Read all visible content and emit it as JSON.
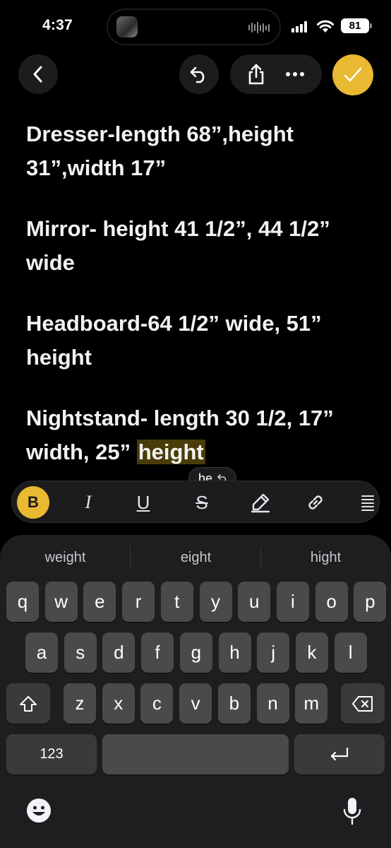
{
  "status_bar": {
    "time": "4:37",
    "battery": "81"
  },
  "toolbar": {
    "back_icon": "chevron-left-icon",
    "undo_icon": "undo-icon",
    "share_icon": "share-icon",
    "more_icon": "more-horizontal-icon",
    "done_icon": "checkmark-icon",
    "accent_color": "#e8b931"
  },
  "note": {
    "lines": [
      {
        "text": "Dresser-length 68”,height 31”,width 17”"
      },
      {
        "text": "Mirror- height 41 1/2”, 44 1/2” wide"
      },
      {
        "text": "Headboard-64 1/2” wide, 51” height"
      },
      {
        "text_before": "Nightstand- length 30 1/2, 17” width, 25” ",
        "highlighted": "height"
      }
    ]
  },
  "autocorrect": {
    "text": "he",
    "icon": "revert-icon"
  },
  "format_bar": {
    "bold": "B",
    "italic": "I",
    "underline": "U",
    "strikethrough": "S",
    "icons": [
      "bold-icon",
      "italic-icon",
      "underline-icon",
      "strikethrough-icon",
      "highlighter-icon",
      "link-icon",
      "list-icon"
    ]
  },
  "keyboard": {
    "suggestions": [
      "weight",
      "eight",
      "hight"
    ],
    "row1": [
      "q",
      "w",
      "e",
      "r",
      "t",
      "y",
      "u",
      "i",
      "o",
      "p"
    ],
    "row2": [
      "a",
      "s",
      "d",
      "f",
      "g",
      "h",
      "j",
      "k",
      "l"
    ],
    "row3": [
      "z",
      "x",
      "c",
      "v",
      "b",
      "n",
      "m"
    ],
    "numbers_label": "123",
    "icons": [
      "shift-icon",
      "delete-icon",
      "return-icon",
      "emoji-icon",
      "microphone-icon"
    ]
  }
}
